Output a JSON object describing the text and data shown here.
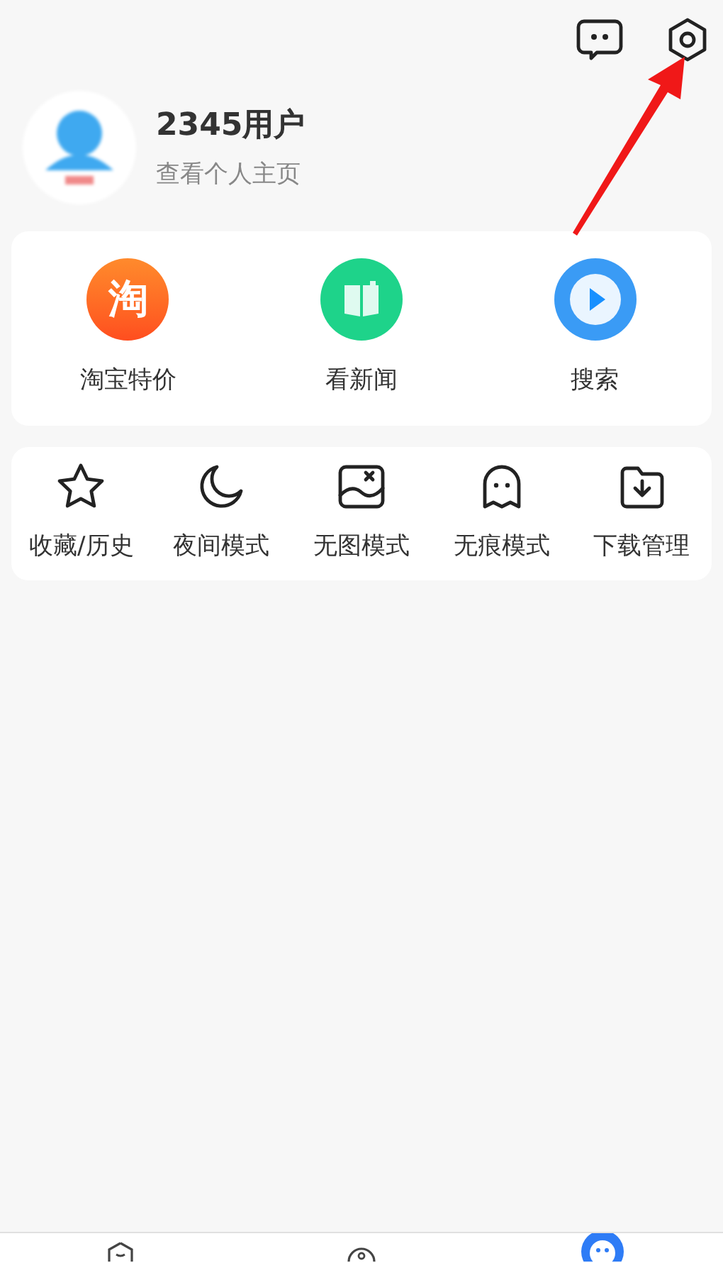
{
  "profile": {
    "name": "2345用户",
    "subtitle": "查看个人主页"
  },
  "quick_actions": [
    {
      "kind": "taobao",
      "label": "淘宝特价",
      "icon_text": "淘"
    },
    {
      "kind": "news",
      "label": "看新闻"
    },
    {
      "kind": "search",
      "label": "搜索"
    }
  ],
  "tools": [
    {
      "kind": "star",
      "label": "收藏/历史"
    },
    {
      "kind": "moon",
      "label": "夜间模式"
    },
    {
      "kind": "noimage",
      "label": "无图模式"
    },
    {
      "kind": "ghost",
      "label": "无痕模式"
    },
    {
      "kind": "download",
      "label": "下载管理"
    }
  ],
  "bottom_nav": [
    {
      "kind": "home",
      "selected": false
    },
    {
      "kind": "discover",
      "selected": false
    },
    {
      "kind": "me",
      "selected": true
    }
  ]
}
